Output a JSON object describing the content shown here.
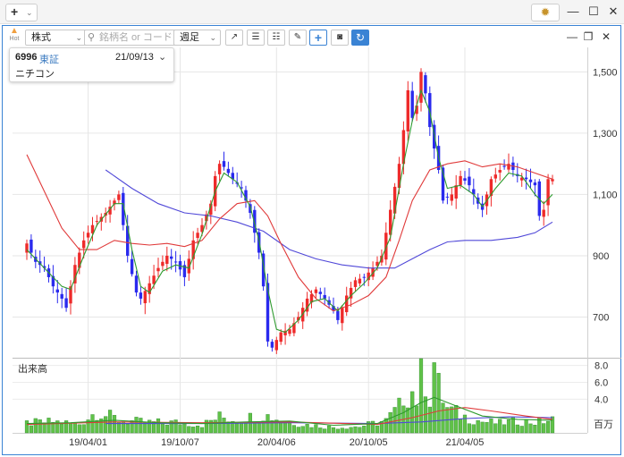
{
  "window": {
    "add_icon": "plus-icon",
    "gear_icon": "gear-icon",
    "minimize_glyph": "—",
    "maximize_glyph": "☐",
    "close_glyph": "✕"
  },
  "toolbar": {
    "hot_label": "Hot",
    "type_select": "株式",
    "search_placeholder": "銘柄名 or コード",
    "period_select": "週足",
    "panel_minimize": "—",
    "panel_maximize": "❐",
    "panel_close": "✕"
  },
  "stock": {
    "code": "6996",
    "market": "東証",
    "date": "21/09/13",
    "name": "ニチコン"
  },
  "chart_data": {
    "type": "candlestick",
    "price_axis": {
      "ticks": [
        700,
        900,
        1100,
        1300,
        1500
      ],
      "tick_labels": [
        "700",
        "900",
        "1,100",
        "1,300",
        "1,500"
      ],
      "ylim": [
        570,
        1580
      ]
    },
    "volume_axis": {
      "title": "出来高",
      "ticks": [
        4.0,
        6.0,
        8.0
      ],
      "tick_labels": [
        "4.0",
        "6.0",
        "8.0"
      ],
      "unit": "百万",
      "ylim": [
        0,
        8.6
      ]
    },
    "x_labels": [
      "19/04/01",
      "19/10/07",
      "20/04/06",
      "20/10/05",
      "21/04/05"
    ],
    "grid": true,
    "colors": {
      "up": "#ee2a2a",
      "down": "#2a2aee",
      "ma_short": "#2e9a2e",
      "ma_mid": "#e03a3a",
      "ma_long": "#5048d8",
      "volume": "#60c248",
      "volume_edge": "#2e8a2e"
    },
    "candle_anchors": [
      {
        "w": 0,
        "c": 940
      },
      {
        "w": 2,
        "c": 880
      },
      {
        "w": 4,
        "c": 860
      },
      {
        "w": 6,
        "c": 800
      },
      {
        "w": 8,
        "c": 760
      },
      {
        "w": 9,
        "c": 730
      },
      {
        "w": 11,
        "c": 870
      },
      {
        "w": 13,
        "c": 950
      },
      {
        "w": 15,
        "c": 1000
      },
      {
        "w": 18,
        "c": 1040
      },
      {
        "w": 20,
        "c": 1080
      },
      {
        "w": 21,
        "c": 1100
      },
      {
        "w": 23,
        "c": 900
      },
      {
        "w": 25,
        "c": 780
      },
      {
        "w": 26,
        "c": 760
      },
      {
        "w": 28,
        "c": 810
      },
      {
        "w": 30,
        "c": 860
      },
      {
        "w": 32,
        "c": 900
      },
      {
        "w": 34,
        "c": 880
      },
      {
        "w": 36,
        "c": 830
      },
      {
        "w": 38,
        "c": 950
      },
      {
        "w": 40,
        "c": 1000
      },
      {
        "w": 42,
        "c": 1070
      },
      {
        "w": 43,
        "c": 1160
      },
      {
        "w": 44,
        "c": 1200
      },
      {
        "w": 45,
        "c": 1190
      },
      {
        "w": 47,
        "c": 1150
      },
      {
        "w": 49,
        "c": 1120
      },
      {
        "w": 51,
        "c": 1040
      },
      {
        "w": 53,
        "c": 910
      },
      {
        "w": 54,
        "c": 800
      },
      {
        "w": 55,
        "c": 620
      },
      {
        "w": 56,
        "c": 600
      },
      {
        "w": 58,
        "c": 650
      },
      {
        "w": 60,
        "c": 660
      },
      {
        "w": 62,
        "c": 700
      },
      {
        "w": 64,
        "c": 760
      },
      {
        "w": 66,
        "c": 790
      },
      {
        "w": 68,
        "c": 760
      },
      {
        "w": 70,
        "c": 720
      },
      {
        "w": 71,
        "c": 690
      },
      {
        "w": 73,
        "c": 770
      },
      {
        "w": 75,
        "c": 820
      },
      {
        "w": 77,
        "c": 830
      },
      {
        "w": 79,
        "c": 860
      },
      {
        "w": 81,
        "c": 900
      },
      {
        "w": 83,
        "c": 1050
      },
      {
        "w": 85,
        "c": 1200
      },
      {
        "w": 86,
        "c": 1310
      },
      {
        "w": 87,
        "c": 1440
      },
      {
        "w": 88,
        "c": 1350
      },
      {
        "w": 89,
        "c": 1390
      },
      {
        "w": 90,
        "c": 1500
      },
      {
        "w": 91,
        "c": 1430
      },
      {
        "w": 92,
        "c": 1320
      },
      {
        "w": 94,
        "c": 1180
      },
      {
        "w": 95,
        "c": 1080
      },
      {
        "w": 97,
        "c": 1100
      },
      {
        "w": 99,
        "c": 1160
      },
      {
        "w": 101,
        "c": 1130
      },
      {
        "w": 103,
        "c": 1070
      },
      {
        "w": 104,
        "c": 1050
      },
      {
        "w": 106,
        "c": 1150
      },
      {
        "w": 108,
        "c": 1180
      },
      {
        "w": 110,
        "c": 1200
      },
      {
        "w": 112,
        "c": 1160
      },
      {
        "w": 114,
        "c": 1150
      },
      {
        "w": 116,
        "c": 1130
      },
      {
        "w": 117,
        "c": 1030
      },
      {
        "w": 118,
        "c": 1050
      },
      {
        "w": 119,
        "c": 1150
      },
      {
        "w": 120,
        "c": 1150
      }
    ],
    "ma_short": [
      [
        0,
        920
      ],
      [
        4,
        860
      ],
      [
        8,
        800
      ],
      [
        10,
        790
      ],
      [
        13,
        900
      ],
      [
        16,
        1000
      ],
      [
        20,
        1070
      ],
      [
        22,
        1070
      ],
      [
        24,
        920
      ],
      [
        26,
        800
      ],
      [
        28,
        780
      ],
      [
        31,
        850
      ],
      [
        34,
        870
      ],
      [
        37,
        860
      ],
      [
        40,
        970
      ],
      [
        43,
        1110
      ],
      [
        45,
        1170
      ],
      [
        48,
        1140
      ],
      [
        51,
        1060
      ],
      [
        53,
        950
      ],
      [
        55,
        790
      ],
      [
        57,
        660
      ],
      [
        59,
        650
      ],
      [
        62,
        690
      ],
      [
        65,
        750
      ],
      [
        68,
        760
      ],
      [
        71,
        720
      ],
      [
        74,
        770
      ],
      [
        77,
        810
      ],
      [
        80,
        860
      ],
      [
        83,
        960
      ],
      [
        86,
        1200
      ],
      [
        88,
        1340
      ],
      [
        90,
        1440
      ],
      [
        92,
        1370
      ],
      [
        94,
        1220
      ],
      [
        96,
        1120
      ],
      [
        99,
        1130
      ],
      [
        102,
        1100
      ],
      [
        104,
        1060
      ],
      [
        107,
        1120
      ],
      [
        110,
        1170
      ],
      [
        113,
        1160
      ],
      [
        116,
        1100
      ],
      [
        118,
        1070
      ],
      [
        120,
        1100
      ]
    ],
    "ma_mid": [
      [
        0,
        1230
      ],
      [
        4,
        1110
      ],
      [
        8,
        990
      ],
      [
        12,
        920
      ],
      [
        16,
        920
      ],
      [
        20,
        950
      ],
      [
        24,
        940
      ],
      [
        28,
        935
      ],
      [
        32,
        940
      ],
      [
        36,
        930
      ],
      [
        40,
        950
      ],
      [
        44,
        1020
      ],
      [
        48,
        1070
      ],
      [
        52,
        1080
      ],
      [
        55,
        1030
      ],
      [
        58,
        940
      ],
      [
        62,
        830
      ],
      [
        66,
        760
      ],
      [
        70,
        720
      ],
      [
        74,
        740
      ],
      [
        78,
        770
      ],
      [
        82,
        830
      ],
      [
        85,
        950
      ],
      [
        88,
        1080
      ],
      [
        92,
        1180
      ],
      [
        96,
        1200
      ],
      [
        100,
        1210
      ],
      [
        104,
        1190
      ],
      [
        108,
        1200
      ],
      [
        112,
        1190
      ],
      [
        116,
        1170
      ],
      [
        120,
        1150
      ]
    ],
    "ma_long": [
      [
        18,
        1180
      ],
      [
        24,
        1120
      ],
      [
        30,
        1070
      ],
      [
        36,
        1040
      ],
      [
        42,
        1030
      ],
      [
        48,
        1010
      ],
      [
        54,
        980
      ],
      [
        60,
        920
      ],
      [
        66,
        890
      ],
      [
        72,
        870
      ],
      [
        78,
        860
      ],
      [
        84,
        860
      ],
      [
        88,
        890
      ],
      [
        92,
        920
      ],
      [
        96,
        945
      ],
      [
        100,
        950
      ],
      [
        106,
        950
      ],
      [
        112,
        960
      ],
      [
        116,
        975
      ],
      [
        120,
        1010
      ]
    ],
    "volume_anchors": [
      [
        0,
        1.2
      ],
      [
        6,
        1.4
      ],
      [
        12,
        1.1
      ],
      [
        16,
        2.7
      ],
      [
        18,
        2.2
      ],
      [
        22,
        1.5
      ],
      [
        28,
        1.3
      ],
      [
        34,
        1.3
      ],
      [
        40,
        1.0
      ],
      [
        44,
        2.0
      ],
      [
        48,
        1.6
      ],
      [
        54,
        2.3
      ],
      [
        58,
        1.6
      ],
      [
        64,
        1.0
      ],
      [
        70,
        0.7
      ],
      [
        76,
        0.8
      ],
      [
        82,
        1.5
      ],
      [
        85,
        3.2
      ],
      [
        86,
        4.8
      ],
      [
        88,
        5.2
      ],
      [
        89,
        4.2
      ],
      [
        90,
        6.8
      ],
      [
        91,
        7.0
      ],
      [
        92,
        4.5
      ],
      [
        93,
        8.8
      ],
      [
        94,
        5.6
      ],
      [
        96,
        3.0
      ],
      [
        100,
        2.0
      ],
      [
        104,
        1.4
      ],
      [
        108,
        1.2
      ],
      [
        112,
        1.5
      ],
      [
        116,
        1.3
      ],
      [
        120,
        1.6
      ]
    ],
    "volume_ma_short": [
      [
        0,
        1.1
      ],
      [
        10,
        1.2
      ],
      [
        20,
        1.5
      ],
      [
        30,
        1.2
      ],
      [
        40,
        1.1
      ],
      [
        50,
        1.3
      ],
      [
        60,
        1.4
      ],
      [
        70,
        0.9
      ],
      [
        80,
        1.1
      ],
      [
        86,
        2.4
      ],
      [
        90,
        3.6
      ],
      [
        93,
        4.2
      ],
      [
        98,
        3.2
      ],
      [
        104,
        2.0
      ],
      [
        112,
        1.6
      ],
      [
        120,
        1.5
      ]
    ],
    "volume_ma_mid": [
      [
        0,
        1.0
      ],
      [
        20,
        1.3
      ],
      [
        40,
        1.2
      ],
      [
        60,
        1.3
      ],
      [
        80,
        1.0
      ],
      [
        88,
        1.8
      ],
      [
        94,
        2.6
      ],
      [
        100,
        3.0
      ],
      [
        106,
        2.6
      ],
      [
        114,
        2.0
      ],
      [
        120,
        1.6
      ]
    ],
    "volume_ma_long": [
      [
        18,
        1.1
      ],
      [
        40,
        1.1
      ],
      [
        60,
        1.2
      ],
      [
        80,
        1.1
      ],
      [
        90,
        1.3
      ],
      [
        100,
        1.7
      ],
      [
        110,
        1.9
      ],
      [
        120,
        1.8
      ]
    ]
  }
}
